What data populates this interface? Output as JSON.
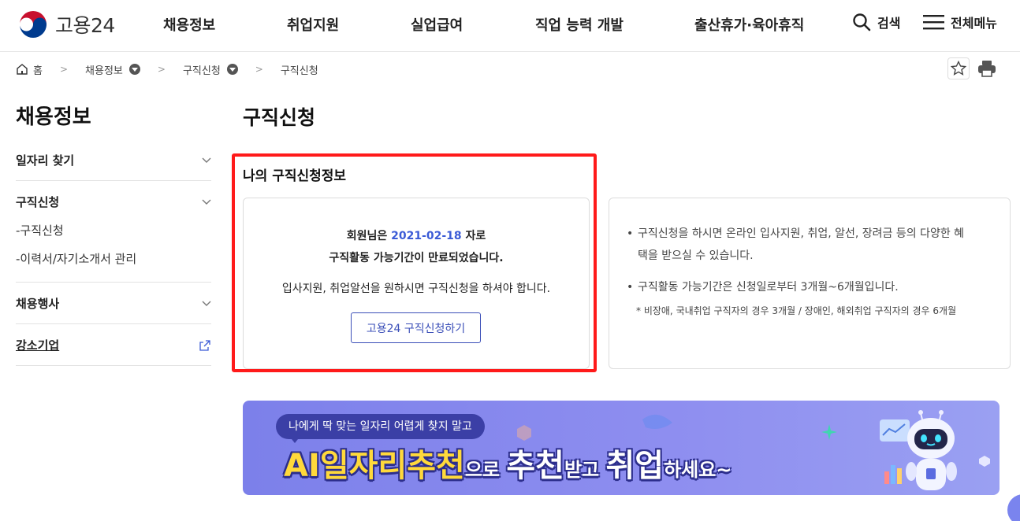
{
  "header": {
    "logo_text": "고용24",
    "nav": [
      "채용정보",
      "취업지원",
      "실업급여",
      "직업 능력 개발",
      "출산휴가·육아휴직"
    ],
    "search_label": "검색",
    "menu_label": "전체메뉴"
  },
  "breadcrumb": {
    "home": "홈",
    "level1": "채용정보",
    "level2": "구직신청",
    "current": "구직신청"
  },
  "sidebar": {
    "title": "채용정보",
    "items": [
      {
        "label": "일자리 찾기"
      },
      {
        "label": "구직신청",
        "subitems": [
          "-구직신청",
          "-이력서/자기소개서 관리"
        ]
      },
      {
        "label": "채용행사"
      },
      {
        "label": "강소기업"
      }
    ]
  },
  "main": {
    "title": "구직신청",
    "info_title": "나의 구직신청정보",
    "line1_prefix": "회원님은 ",
    "line1_date": "2021-02-18",
    "line1_suffix": " 자로",
    "line2": "구직활동 가능기간이 만료되었습니다.",
    "line3": "입사지원, 취업알선을 원하시면 구직신청을 하셔야 합니다.",
    "apply_button": "고용24 구직신청하기",
    "bullet1_a": "구직신청을 하시면 온라인 입사지원, 취업, 알선, 장려금 등의 다양한 혜",
    "bullet1_b": "택을 받으실 수 있습니다.",
    "bullet2": "구직활동 가능기간은 신청일로부터 3개월~6개월입니다.",
    "note": "* 비장애, 국내취업 구직자의 경우 3개월 / 장애인, 해외취업 구직자의 경우 6개월"
  },
  "banner": {
    "bubble": "나에게 딱 맞는 일자리 어렵게 찾지 말고",
    "head_1": "AI일자리추천",
    "head_2": "으로 ",
    "head_3": "추천",
    "head_4": "받고 ",
    "head_5": "취업",
    "head_6": "하세요~"
  },
  "colors": {
    "accent": "#3b5bd6",
    "highlight_frame": "#ff1a1a",
    "banner_bg": "#8288ec"
  }
}
